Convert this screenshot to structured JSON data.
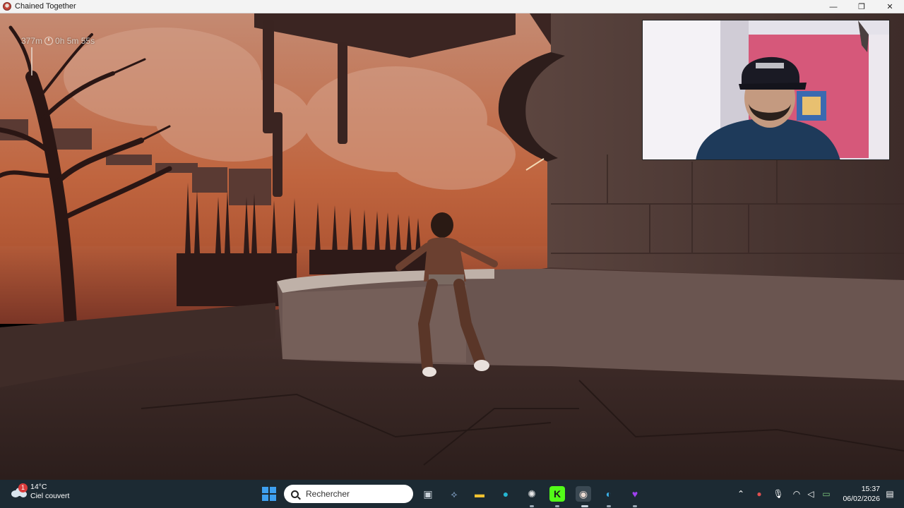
{
  "window": {
    "title": "Chained Together",
    "minimize_glyph": "—",
    "maximize_glyph": "❐",
    "close_glyph": "✕"
  },
  "hud": {
    "distance": "377m",
    "timer": "0h 5m 55s"
  },
  "taskbar": {
    "weather": {
      "temperature": "14°C",
      "condition": "Ciel couvert",
      "notification_count": "1"
    },
    "search": {
      "label": "Rechercher"
    },
    "pinned_apps": [
      {
        "name": "task-view-icon",
        "glyph": "▣"
      },
      {
        "name": "app-icon",
        "glyph": "⟡"
      },
      {
        "name": "file-explorer-icon",
        "glyph": "▬"
      },
      {
        "name": "canva-icon",
        "glyph": "●"
      },
      {
        "name": "chatgpt-icon",
        "glyph": "✺"
      },
      {
        "name": "kick-icon",
        "glyph": "K"
      },
      {
        "name": "chained-together-icon",
        "glyph": "◉"
      },
      {
        "name": "edge-icon",
        "glyph": "◐"
      },
      {
        "name": "heart-app-icon",
        "glyph": "♥"
      }
    ],
    "tray": {
      "chevron": "⌃",
      "time": "15:37",
      "date": "06/02/2026"
    }
  },
  "colors": {
    "taskbar_bg": "#1c2a33",
    "sky_top": "#c9886a",
    "sky_bottom": "#b8562f",
    "ground": "#3a2824"
  }
}
